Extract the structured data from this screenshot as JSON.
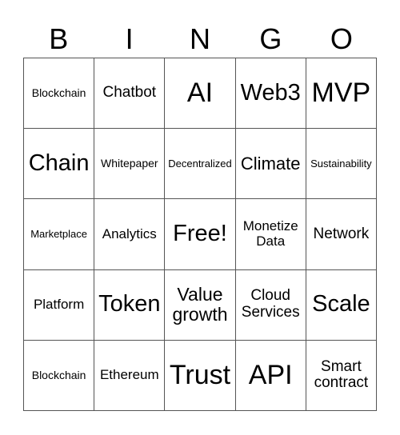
{
  "header": {
    "letters": [
      "B",
      "I",
      "N",
      "G",
      "O"
    ]
  },
  "card": {
    "cells": [
      [
        "Blockchain",
        "Chatbot",
        "AI",
        "Web3",
        "MVP"
      ],
      [
        "Chain",
        "Whitepaper",
        "Decentralized",
        "Climate",
        "Sustainability"
      ],
      [
        "Marketplace",
        "Analytics",
        "Free!",
        "Monetize Data",
        "Network"
      ],
      [
        "Platform",
        "Token",
        "Value growth",
        "Cloud Services",
        "Scale"
      ],
      [
        "Blockchain",
        "Ethereum",
        "Trust",
        "API",
        "Smart contract"
      ]
    ]
  }
}
